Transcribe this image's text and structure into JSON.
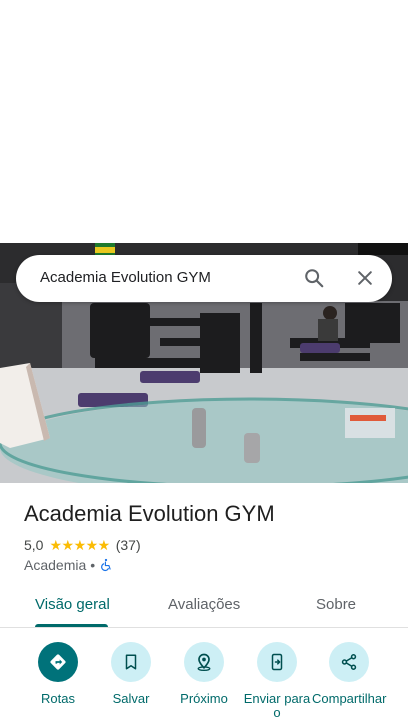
{
  "search": {
    "query": "Academia Evolution GYM"
  },
  "place": {
    "name": "Academia Evolution GYM",
    "rating": "5,0",
    "stars": "★★★★★",
    "review_count": "(37)",
    "category": "Academia",
    "separator": "•"
  },
  "tabs": [
    {
      "label": "Visão geral",
      "active": true
    },
    {
      "label": "Avaliações",
      "active": false
    },
    {
      "label": "Sobre",
      "active": false
    }
  ],
  "actions": [
    {
      "label": "Rotas",
      "icon": "directions-icon"
    },
    {
      "label": "Salvar",
      "icon": "bookmark-icon"
    },
    {
      "label": "Próximo",
      "icon": "nearby-icon"
    },
    {
      "label": "Enviar para o",
      "icon": "send-to-phone-icon"
    },
    {
      "label": "Compartilhar",
      "icon": "share-icon"
    }
  ],
  "colors": {
    "accent": "#006a6a",
    "star": "#fbbc04",
    "action_bg": "#cdeff5",
    "primary_action": "#00727a"
  }
}
